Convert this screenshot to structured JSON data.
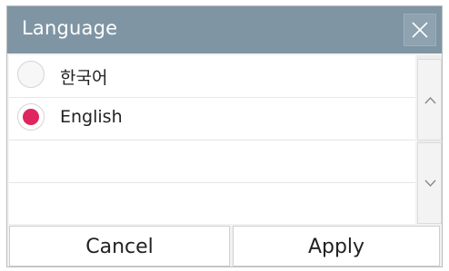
{
  "dialog": {
    "title": "Language",
    "close_icon": "close-icon",
    "colors": {
      "titlebar": "#7f95a4",
      "selected_radio": "#e0245e"
    }
  },
  "languages": [
    {
      "label": "한국어",
      "selected": false
    },
    {
      "label": "English",
      "selected": true
    }
  ],
  "scroll": {
    "up_icon": "chevron-up-icon",
    "down_icon": "chevron-down-icon"
  },
  "footer": {
    "cancel_label": "Cancel",
    "apply_label": "Apply"
  }
}
